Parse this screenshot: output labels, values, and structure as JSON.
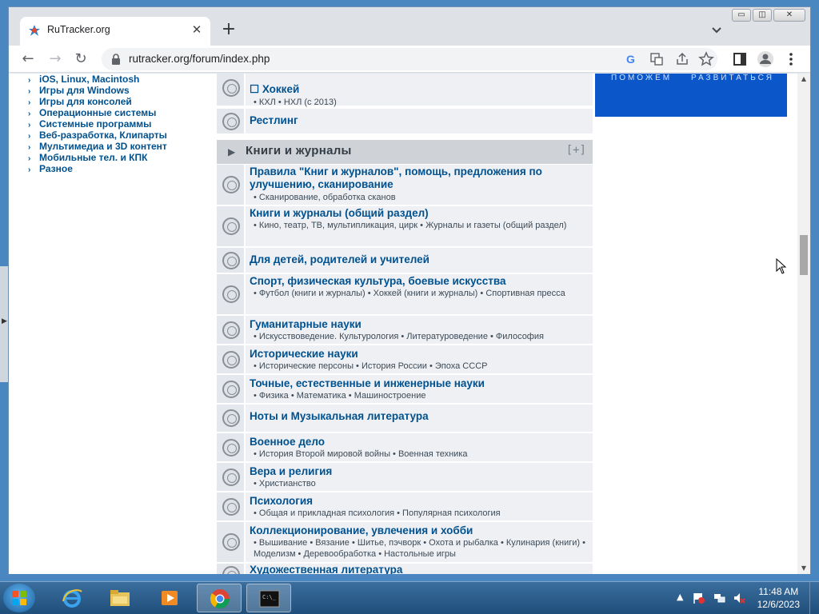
{
  "browser": {
    "tab_title": "RuTracker.org",
    "tab_close": "✕",
    "new_tab": "+",
    "url": "rutracker.org/forum/index.php",
    "back": "←",
    "forward": "→",
    "reload": "↻",
    "win_minimize": "▭",
    "win_restore": "◫",
    "win_close": "✕"
  },
  "left_categories": [
    "iOS, Linux, Macintosh",
    "Игры для Windows",
    "Игры для консолей",
    "Операционные системы",
    "Системные программы",
    "Веб-разработка, Клипарты",
    "Мультимедиа и 3D контент",
    "Мобильные тел. и КПК",
    "Разное"
  ],
  "forum_rows_top": [
    {
      "title": "☐ Хоккей",
      "subs": "• КХЛ • НХЛ (с 2013)"
    },
    {
      "title": "Рестлинг",
      "subs": ""
    }
  ],
  "section": {
    "title": "Книги и журналы",
    "toggle": "[+]"
  },
  "forum_rows": [
    {
      "title": "Правила \"Книг и журналов\", помощь, предложения по улучшению, сканирование",
      "subs": "• Сканирование, обработка сканов"
    },
    {
      "title": "Книги и журналы (общий раздел)",
      "subs": "• Кино, театр, ТВ, мультипликация, цирк • Журналы и газеты (общий раздел)"
    },
    {
      "title": "Для детей, родителей и учителей",
      "subs": ""
    },
    {
      "title": "Спорт, физическая культура, боевые искусства",
      "subs": "• Футбол (книги и журналы) • Хоккей (книги и журналы) • Спортивная пресса"
    },
    {
      "title": "Гуманитарные науки",
      "subs": "• Искусствоведение. Культурология • Литературоведение • Философия"
    },
    {
      "title": "Исторические науки",
      "subs": "• Исторические персоны • История России • Эпоха СССР"
    },
    {
      "title": "Точные, естественные и инженерные науки",
      "subs": "• Физика • Математика • Машиностроение"
    },
    {
      "title": "Ноты и Музыкальная литература",
      "subs": ""
    },
    {
      "title": "Военное дело",
      "subs": "• История Второй мировой войны • Военная техника"
    },
    {
      "title": "Вера и религия",
      "subs": "• Христианство"
    },
    {
      "title": "Психология",
      "subs": "• Общая и прикладная психология • Популярная психология"
    },
    {
      "title": "Коллекционирование, увлечения и хобби",
      "subs": "• Вышивание • Вязание • Шитье, пэчворк • Охота и рыбалка • Кулинария (книги) • Моделизм • Деревообработка • Настольные игры"
    },
    {
      "title": "Художественная литература",
      "subs": ""
    }
  ],
  "banner_text": [
    "ПОМОЖЕМ",
    "РАЗВИТАТЬСЯ"
  ],
  "taskbar": {
    "time": "11:48 AM",
    "date": "12/6/2023",
    "tray_arrow": "▲"
  },
  "colors": {
    "link": "#00518f",
    "section_bg": "#cfd3d8",
    "row_bg": "#eef0f3",
    "banner": "#0b57c9"
  }
}
